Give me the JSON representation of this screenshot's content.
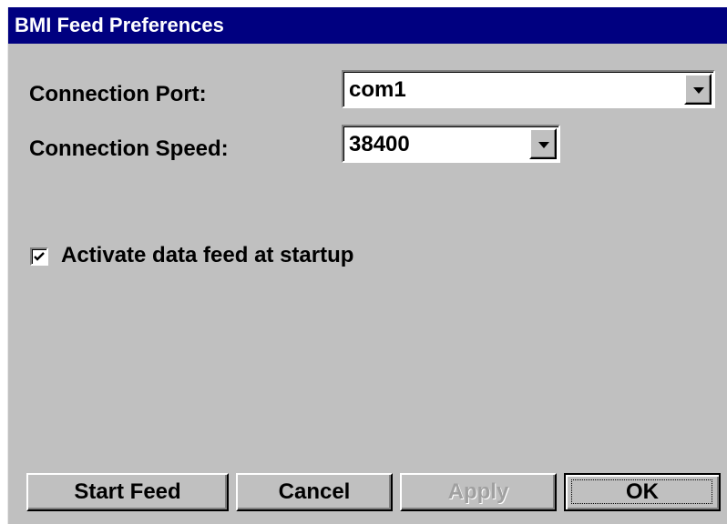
{
  "window": {
    "title": "BMI Feed Preferences"
  },
  "form": {
    "port_label": "Connection Port:",
    "port_value": "com1",
    "speed_label": "Connection Speed:",
    "speed_value": "38400",
    "activate_label": "Activate data feed at startup",
    "activate_checked": true
  },
  "buttons": {
    "start_feed": "Start Feed",
    "cancel": "Cancel",
    "apply": "Apply",
    "ok": "OK"
  },
  "colors": {
    "titlebar": "#000080",
    "face": "#c0c0c0",
    "disabled_text": "#a0a0a0"
  },
  "icons": {
    "dropdown": "chevron-down-icon",
    "check": "checkmark-icon"
  }
}
